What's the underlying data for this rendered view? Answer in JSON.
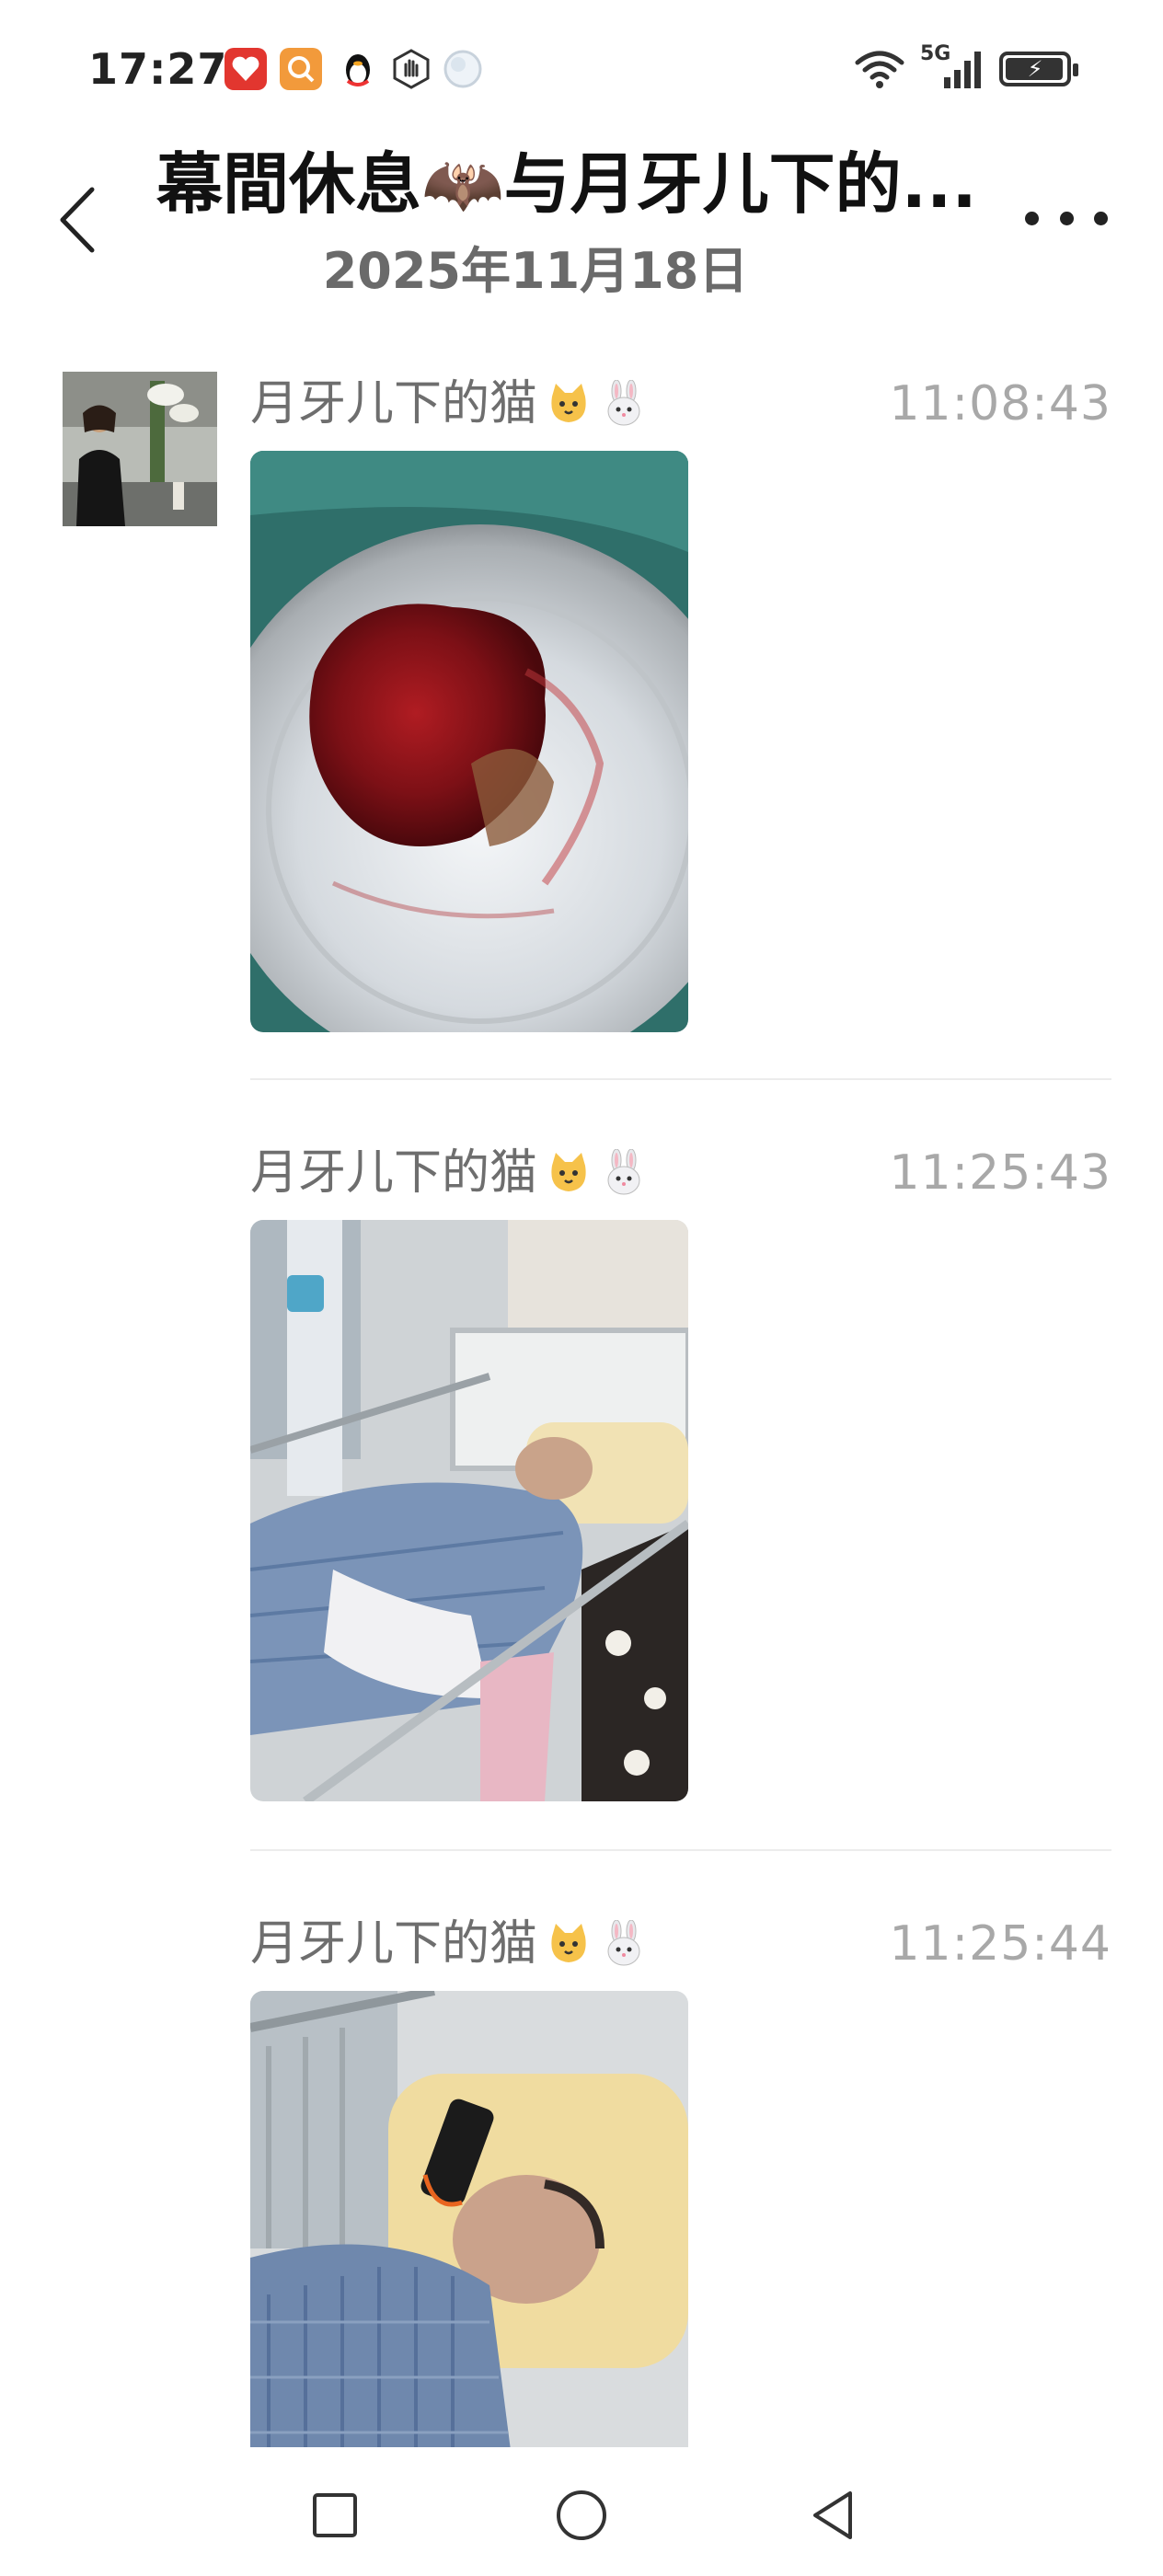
{
  "status_bar": {
    "time": "17:27",
    "notification_icons": [
      "heart-app-icon",
      "search-app-icon",
      "qq-penguin-icon",
      "hand-app-icon",
      "moon-app-icon"
    ],
    "network": "5G",
    "icons": [
      "wifi-icon",
      "cellular-signal-icon",
      "battery-charging-icon"
    ]
  },
  "header": {
    "title": "幕間休息🦇与月牙儿下的...",
    "date": "2025年11月18日",
    "back_icon": "chevron-left-icon",
    "more_icon": "more-dots-icon"
  },
  "messages": [
    {
      "sender": "月牙儿下的猫🐱🐰",
      "time": "11:08:43",
      "image": "photo-bloody-tissue-in-metal-bowl"
    },
    {
      "sender": "月牙儿下的猫🐱🐰",
      "time": "11:25:43",
      "image": "photo-patient-in-hospital-bed"
    },
    {
      "sender": "月牙儿下的猫🐱🐰",
      "time": "11:25:44",
      "image": "photo-patient-closeup-on-pillow"
    }
  ],
  "sender_name": "月牙儿下的猫",
  "nav_bar": {
    "buttons": [
      "recent-apps-icon",
      "home-icon",
      "back-triangle-icon"
    ]
  },
  "colors": {
    "title": "#111111",
    "date": "#6a6a6a",
    "sender": "#6e6e6e",
    "time": "#a8a8a8",
    "divider": "#ececec"
  }
}
